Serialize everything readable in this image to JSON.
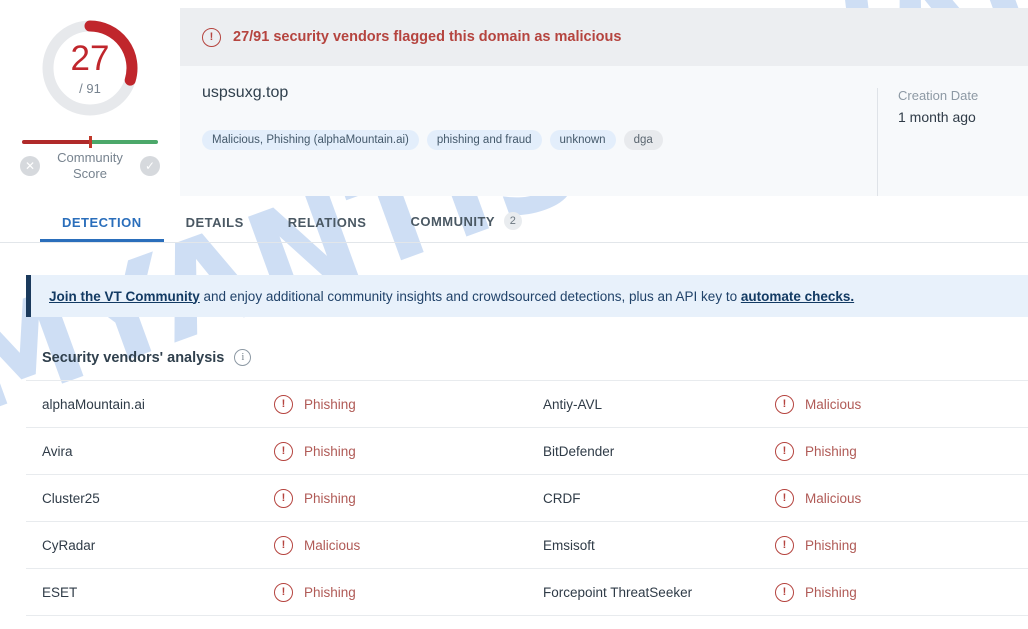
{
  "watermark": "MYANTISPYWARE.COM",
  "score": {
    "value": "27",
    "total": "/ 91",
    "arc_color": "#c0262c",
    "track_color": "#e7e9ec",
    "detections": 27,
    "engines": 91
  },
  "community": {
    "label": "Community\nScore",
    "label_line1": "Community",
    "label_line2": "Score",
    "negative_icon": "✕",
    "positive_icon": "✓"
  },
  "alert": {
    "icon": "!",
    "text": "27/91 security vendors flagged this domain as malicious",
    "color": "#b5443f"
  },
  "detail": {
    "domain": "uspsuxg.top",
    "tags": [
      {
        "label": "Malicious, Phishing (alphaMountain.ai)",
        "style": "blue"
      },
      {
        "label": "phishing and fraud",
        "style": "blue"
      },
      {
        "label": "unknown",
        "style": "blue"
      },
      {
        "label": "dga",
        "style": "grey"
      }
    ],
    "creation_label": "Creation Date",
    "creation_value": "1 month ago"
  },
  "tabs": [
    {
      "label": "DETECTION",
      "active": true,
      "badge": ""
    },
    {
      "label": "DETAILS",
      "active": false,
      "badge": ""
    },
    {
      "label": "RELATIONS",
      "active": false,
      "badge": ""
    },
    {
      "label": "COMMUNITY",
      "active": false,
      "badge": "2"
    }
  ],
  "banner": {
    "link1": "Join the VT Community",
    "middle": " and enjoy additional community insights and crowdsourced detections, plus an API key to ",
    "link2": "automate checks."
  },
  "vendors": {
    "title": "Security vendors' analysis",
    "info_icon": "i",
    "verdict_icon": "!",
    "rows": [
      {
        "left_name": "alphaMountain.ai",
        "left_verdict": "Phishing",
        "right_name": "Antiy-AVL",
        "right_verdict": "Malicious"
      },
      {
        "left_name": "Avira",
        "left_verdict": "Phishing",
        "right_name": "BitDefender",
        "right_verdict": "Phishing"
      },
      {
        "left_name": "Cluster25",
        "left_verdict": "Phishing",
        "right_name": "CRDF",
        "right_verdict": "Malicious"
      },
      {
        "left_name": "CyRadar",
        "left_verdict": "Malicious",
        "right_name": "Emsisoft",
        "right_verdict": "Phishing"
      },
      {
        "left_name": "ESET",
        "left_verdict": "Phishing",
        "right_name": "Forcepoint ThreatSeeker",
        "right_verdict": "Phishing"
      }
    ]
  }
}
